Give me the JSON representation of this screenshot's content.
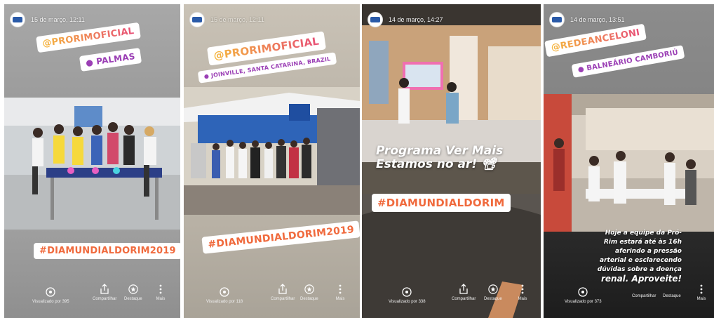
{
  "stories": [
    {
      "date": "15 de março, 12:11",
      "username_sticker": "@PRORIMOFICIAL",
      "location_sticker": "PALMAS",
      "hashtag_sticker": "#DIAMUNDIALDORIM2019",
      "actions": {
        "views": "Visualizado por 395",
        "share": "Compartilhar",
        "highlight": "Destaque",
        "more": "Mais"
      }
    },
    {
      "date": "15 de março, 12:11",
      "username_sticker": "@PRORIMOFICIAL",
      "location_sticker": "JOINVILLE, SANTA CATARINA, BRAZIL",
      "hashtag_sticker": "#DIAMUNDIALDORIM2019",
      "actions": {
        "views": "Visualizado por 118",
        "share": "Compartilhar",
        "highlight": "Destaque",
        "more": "Mais"
      }
    },
    {
      "date": "14 de março, 14:27",
      "overlay_text_line1": "Programa Ver Mais",
      "overlay_text_line2": "Estamos no ar! 📽",
      "hashtag_sticker": "#DIAMUNDIALDORIM",
      "actions": {
        "views": "Visualizado por 338",
        "share": "Compartilhar",
        "highlight": "Destaque",
        "more": "Mais"
      }
    },
    {
      "date": "14 de março, 13:51",
      "username_sticker": "@REDEANCELONI",
      "location_sticker": "BALNEÁRIO CAMBORIÚ",
      "caption": {
        "line1": "Hoje a equipe da Pró-",
        "line2": "Rim estará até às 16h",
        "line3": "aferindo a pressão",
        "line4": "arterial e esclarecendo",
        "line5": "dúvidas sobre a doença",
        "line6": "renal. Aproveite!"
      },
      "actions": {
        "views": "Visualizado por 373",
        "share": "Compartilhar",
        "highlight": "Destaque",
        "more": "Mais"
      }
    }
  ],
  "colors": {
    "sticker_orange": "#f2a93b",
    "sticker_purple": "#9b3fb5",
    "hashtag_orange": "#f06a3d"
  },
  "icons": [
    "avatar-logo",
    "eye-icon",
    "share-icon",
    "highlight-icon",
    "more-icon",
    "location-pin-icon"
  ]
}
